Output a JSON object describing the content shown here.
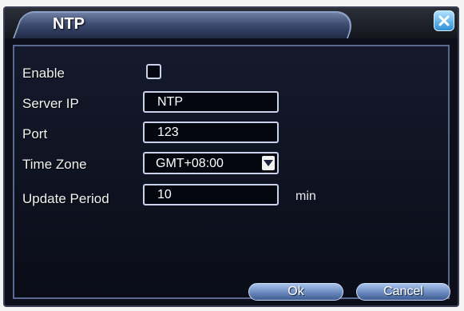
{
  "dialog": {
    "title": "NTP",
    "close_icon": "close-x-icon"
  },
  "form": {
    "enable_label": "Enable",
    "enable_checked": false,
    "server_ip_label": "Server IP",
    "server_ip_value": "NTP",
    "port_label": "Port",
    "port_value": "123",
    "time_zone_label": "Time Zone",
    "time_zone_value": "GMT+08:00",
    "update_period_label": "Update Period",
    "update_period_value": "10",
    "update_period_unit": "min"
  },
  "buttons": {
    "ok_label": "Ok",
    "cancel_label": "Cancel"
  },
  "colors": {
    "accent": "#6f8fc3",
    "close_button": "#2f8fd6"
  }
}
